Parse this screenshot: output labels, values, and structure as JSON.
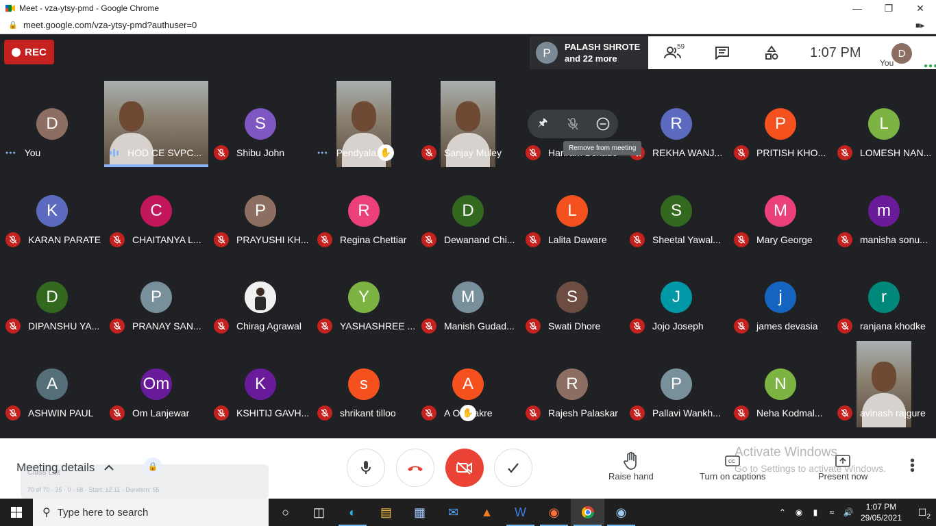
{
  "browser": {
    "window_title": "Meet - vza-ytsy-pmd - Google Chrome",
    "url": "meet.google.com/vza-ytsy-pmd?authuser=0"
  },
  "meet_top": {
    "rec_label": "REC",
    "presenter_initial": "P",
    "presenter_line1": "PALASH SHROTE",
    "presenter_line2": "and 22 more",
    "people_count": "59",
    "time": "1:07 PM",
    "you_initial": "D",
    "you_label": "You"
  },
  "participants": [
    {
      "name": "You",
      "initial": "D",
      "color": "#8d6e63",
      "status": "dots"
    },
    {
      "name": "HOD CE SVPC...",
      "initial": "",
      "color": "",
      "status": "speaking",
      "video": true
    },
    {
      "name": "Shibu John",
      "initial": "S",
      "color": "#7e57c2",
      "status": "muted"
    },
    {
      "name": "Pendyala...",
      "initial": "",
      "color": "",
      "status": "dots",
      "video": true,
      "hand": true
    },
    {
      "name": "Sanjay Muley",
      "initial": "",
      "color": "",
      "status": "muted",
      "video": true
    },
    {
      "name": "Hariram Bokade",
      "initial": "",
      "color": "",
      "status": "muted"
    },
    {
      "name": "REKHA WANJ...",
      "initial": "R",
      "color": "#5c6bc0",
      "status": "muted"
    },
    {
      "name": "PRITISH KHO...",
      "initial": "P",
      "color": "#f4511e",
      "status": "muted"
    },
    {
      "name": "LOMESH NAN...",
      "initial": "L",
      "color": "#7cb342",
      "status": "muted"
    },
    {
      "name": "KARAN PARATE",
      "initial": "K",
      "color": "#5c6bc0",
      "status": "muted"
    },
    {
      "name": "CHAITANYA L...",
      "initial": "C",
      "color": "#c2185b",
      "status": "muted"
    },
    {
      "name": "PRAYUSHI KH...",
      "initial": "P",
      "color": "#8d6e63",
      "status": "muted"
    },
    {
      "name": "Regina Chettiar",
      "initial": "R",
      "color": "#ec407a",
      "status": "muted"
    },
    {
      "name": "Dewanand Chi...",
      "initial": "D",
      "color": "#33691e",
      "status": "muted"
    },
    {
      "name": "Lalita Daware",
      "initial": "L",
      "color": "#f4511e",
      "status": "muted"
    },
    {
      "name": "Sheetal Yawal...",
      "initial": "S",
      "color": "#33691e",
      "status": "muted"
    },
    {
      "name": "Mary George",
      "initial": "M",
      "color": "#ec407a",
      "status": "muted"
    },
    {
      "name": "manisha sonu...",
      "initial": "m",
      "color": "#6a1b9a",
      "status": "muted"
    },
    {
      "name": "DIPANSHU YA...",
      "initial": "D",
      "color": "#33691e",
      "status": "muted"
    },
    {
      "name": "PRANAY SAN...",
      "initial": "P",
      "color": "#78909c",
      "status": "muted"
    },
    {
      "name": "Chirag Agrawal",
      "initial": "",
      "color": "#eeeeee",
      "status": "muted",
      "photo": true
    },
    {
      "name": "YASHASHREE ...",
      "initial": "Y",
      "color": "#7cb342",
      "status": "muted"
    },
    {
      "name": "Manish Gudad...",
      "initial": "M",
      "color": "#78909c",
      "status": "muted"
    },
    {
      "name": "Swati Dhore",
      "initial": "S",
      "color": "#6d4c41",
      "status": "muted"
    },
    {
      "name": "Jojo Joseph",
      "initial": "J",
      "color": "#0097a7",
      "status": "muted"
    },
    {
      "name": "james devasia",
      "initial": "j",
      "color": "#1565c0",
      "status": "muted"
    },
    {
      "name": "ranjana khodke",
      "initial": "r",
      "color": "#00897b",
      "status": "muted"
    },
    {
      "name": "ASHWIN PAUL",
      "initial": "A",
      "color": "#546e7a",
      "status": "muted"
    },
    {
      "name": "Om Lanjewar",
      "initial": "Om",
      "color": "#6a1b9a",
      "status": "muted"
    },
    {
      "name": "KSHITIJ GAVH...",
      "initial": "K",
      "color": "#6a1b9a",
      "status": "muted"
    },
    {
      "name": "shrikant tilloo",
      "initial": "s",
      "color": "#f4511e",
      "status": "muted"
    },
    {
      "name": "A O Thakre",
      "initial": "A",
      "color": "#f4511e",
      "status": "muted",
      "hand": true
    },
    {
      "name": "Rajesh Palaskar",
      "initial": "R",
      "color": "#8d6e63",
      "status": "muted"
    },
    {
      "name": "Pallavi Wankh...",
      "initial": "P",
      "color": "#78909c",
      "status": "muted"
    },
    {
      "name": "Neha Kodmal...",
      "initial": "N",
      "color": "#7cb342",
      "status": "muted"
    },
    {
      "name": "avinash rajgure",
      "initial": "",
      "color": "",
      "status": "muted",
      "video": true
    }
  ],
  "hover_tooltip": "Remove from meeting",
  "bottom": {
    "meeting_details": "Meeting details",
    "ghost_title": "Class List",
    "ghost_stats": "70 of 70 · 35 · 0 · 68 · Start: 12:11 · Duration: 55",
    "raise_hand": "Raise hand",
    "captions": "Turn on captions",
    "present": "Present now",
    "activate_line1": "Activate Windows",
    "activate_line2": "Go to Settings to activate Windows."
  },
  "taskbar": {
    "search_placeholder": "Type here to search",
    "time": "1:07 PM",
    "date": "29/05/2021",
    "notifications": "2"
  }
}
